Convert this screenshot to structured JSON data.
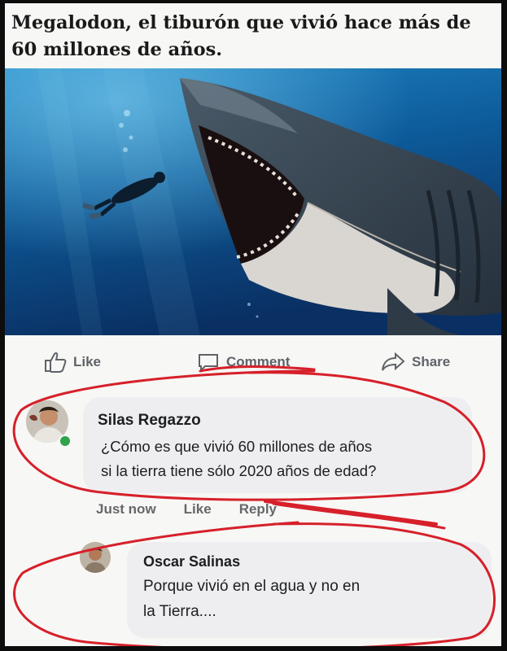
{
  "post": {
    "caption": "Megalodon, el tiburón que vivió hace más de 60 millones de años."
  },
  "actions": {
    "like": "Like",
    "comment": "Comment",
    "share": "Share"
  },
  "comments": [
    {
      "author": "Silas Regazzo",
      "text_line1": "¿Cómo es que vivió 60 millones de años",
      "text_line2": "si la tierra tiene sólo 2020 años de edad?",
      "timestamp": "Just now",
      "like_label": "Like",
      "reply_label": "Reply"
    },
    {
      "author": "Oscar Salinas",
      "text_line1": "Porque vivió en el agua y no en",
      "text_line2": "la Tierra...."
    }
  ],
  "colors": {
    "scribble": "#d6202a",
    "online": "#31a24c",
    "water_dark": "#0a2a55",
    "water_light": "#2a8ec8"
  },
  "icons": {
    "like": "thumbs-up-icon",
    "comment": "speech-bubble-icon",
    "share": "share-arrow-icon"
  }
}
